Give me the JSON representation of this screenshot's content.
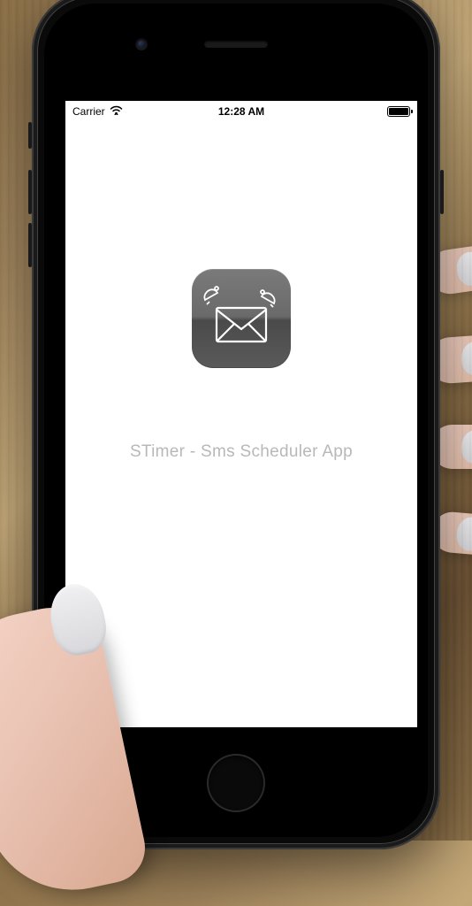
{
  "status_bar": {
    "carrier": "Carrier",
    "time": "12:28 AM"
  },
  "app": {
    "title": "STimer - Sms Scheduler App",
    "icon_name": "envelope-bells-icon"
  }
}
